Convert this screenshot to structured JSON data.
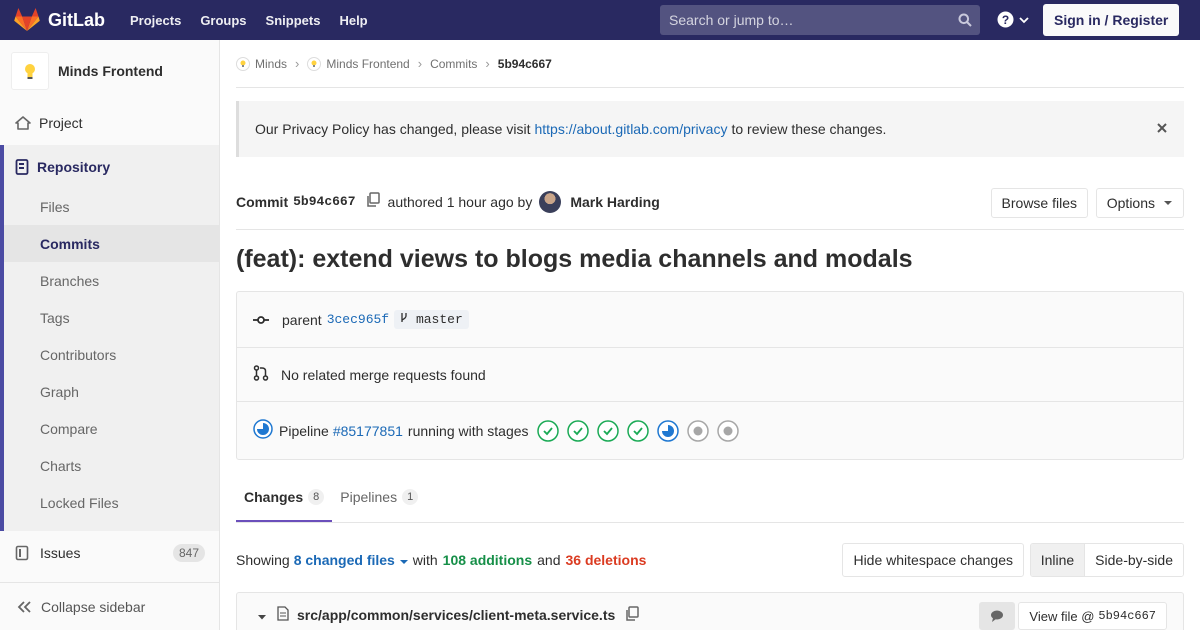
{
  "navbar": {
    "brand": "GitLab",
    "links": [
      "Projects",
      "Groups",
      "Snippets",
      "Help"
    ],
    "search_placeholder": "Search or jump to…",
    "signin": "Sign in / Register"
  },
  "sidebar": {
    "project_name": "Minds Frontend",
    "project": "Project",
    "repository": "Repository",
    "repo_items": [
      "Files",
      "Commits",
      "Branches",
      "Tags",
      "Contributors",
      "Graph",
      "Compare",
      "Charts",
      "Locked Files"
    ],
    "active_item": "Commits",
    "issues": "Issues",
    "issues_count": "847",
    "collapse": "Collapse sidebar"
  },
  "breadcrumb": [
    "Minds",
    "Minds Frontend",
    "Commits",
    "5b94c667"
  ],
  "alert": {
    "before": "Our Privacy Policy has changed, please visit",
    "link": "https://about.gitlab.com/privacy",
    "after": "to review these changes."
  },
  "commit": {
    "label": "Commit",
    "sha": "5b94c667",
    "authored": "authored 1 hour ago by",
    "author": "Mark Harding",
    "browse_files": "Browse files",
    "options": "Options",
    "title": "(feat): extend views to blogs media channels and modals",
    "parent_label": "parent",
    "parent_sha": "3cec965f",
    "branch": "master",
    "merge_requests": "No related merge requests found",
    "pipeline_label": "Pipeline",
    "pipeline_id": "#85177851",
    "pipeline_status": "running with stages",
    "stages": [
      "success",
      "success",
      "success",
      "success",
      "running",
      "created",
      "created"
    ]
  },
  "tabs": [
    {
      "label": "Changes",
      "count": "8"
    },
    {
      "label": "Pipelines",
      "count": "1"
    }
  ],
  "diff_summary": {
    "showing": "Showing",
    "changed": "8 changed files",
    "with": "with",
    "additions": "108 additions",
    "and": "and",
    "deletions": "36 deletions",
    "hide_whitespace": "Hide whitespace changes",
    "inline": "Inline",
    "side_by_side": "Side-by-side"
  },
  "file": {
    "path": "src/app/common/services/client-meta.service.ts",
    "view_label": "View file @",
    "view_sha": "5b94c667"
  },
  "colors": {
    "navbar": "#292961",
    "accent": "#4b4ba3",
    "link": "#1b69b6",
    "success": "#1aaa55",
    "running": "#1f78d1",
    "additions": "#168f48",
    "deletions": "#db3b21"
  }
}
